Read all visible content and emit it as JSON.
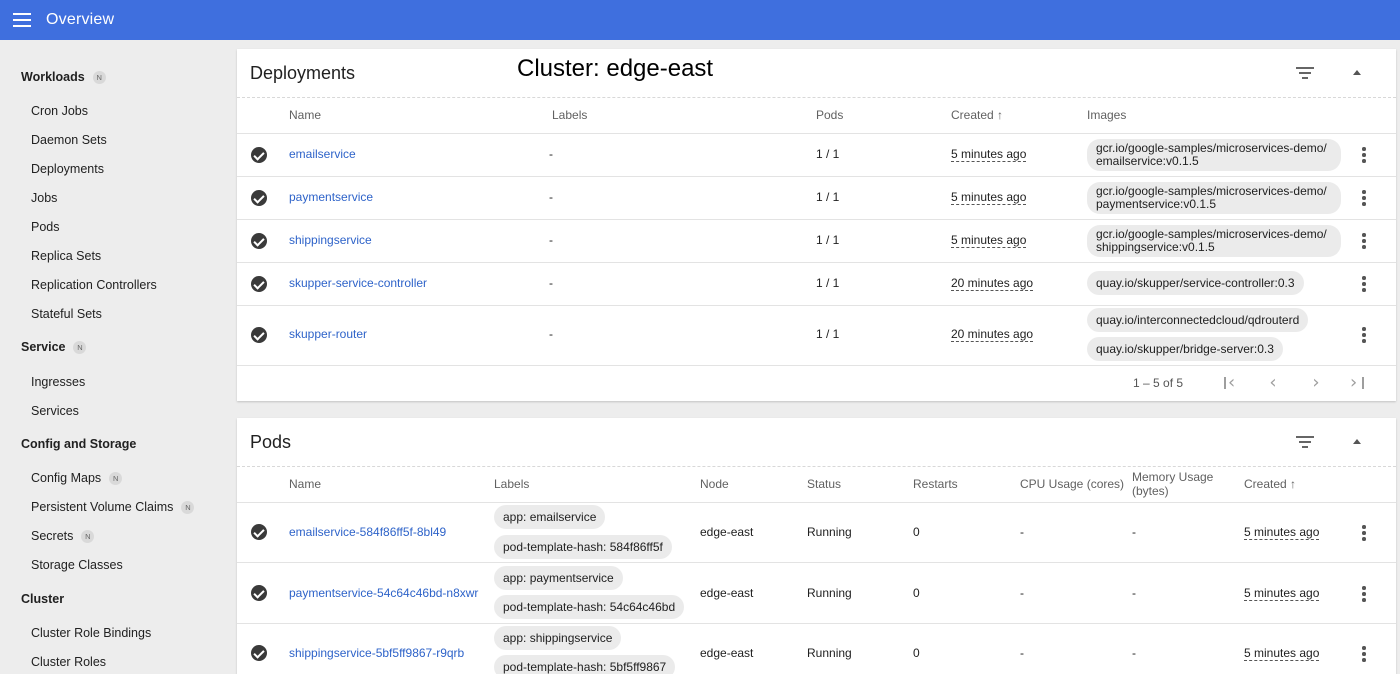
{
  "app": {
    "title": "Overview"
  },
  "sidebar": {
    "sections": [
      {
        "label": "Workloads",
        "badge": "N",
        "items": [
          {
            "label": "Cron Jobs"
          },
          {
            "label": "Daemon Sets"
          },
          {
            "label": "Deployments"
          },
          {
            "label": "Jobs"
          },
          {
            "label": "Pods"
          },
          {
            "label": "Replica Sets"
          },
          {
            "label": "Replication Controllers"
          },
          {
            "label": "Stateful Sets"
          }
        ]
      },
      {
        "label": "Service",
        "badge": "N",
        "items": [
          {
            "label": "Ingresses"
          },
          {
            "label": "Services"
          }
        ]
      },
      {
        "label": "Config and Storage",
        "badge": "",
        "items": [
          {
            "label": "Config Maps",
            "badge": "N"
          },
          {
            "label": "Persistent Volume Claims",
            "badge": "N"
          },
          {
            "label": "Secrets",
            "badge": "N"
          },
          {
            "label": "Storage Classes"
          }
        ]
      },
      {
        "label": "Cluster",
        "badge": "",
        "items": [
          {
            "label": "Cluster Role Bindings"
          },
          {
            "label": "Cluster Roles"
          }
        ]
      }
    ]
  },
  "deployments": {
    "title": "Deployments",
    "cluster_title": "Cluster: edge-east",
    "columns": {
      "name": "Name",
      "labels": "Labels",
      "pods": "Pods",
      "created": "Created",
      "created_sort": "↑",
      "images": "Images"
    },
    "rows": [
      {
        "name": "emailservice",
        "labels": "-",
        "pods": "1 / 1",
        "created": "5 minutes ago",
        "images": [
          "gcr.io/google-samples/microservices-demo/emailservice:v0.1.5"
        ]
      },
      {
        "name": "paymentservice",
        "labels": "-",
        "pods": "1 / 1",
        "created": "5 minutes ago",
        "images": [
          "gcr.io/google-samples/microservices-demo/paymentservice:v0.1.5"
        ]
      },
      {
        "name": "shippingservice",
        "labels": "-",
        "pods": "1 / 1",
        "created": "5 minutes ago",
        "images": [
          "gcr.io/google-samples/microservices-demo/shippingservice:v0.1.5"
        ]
      },
      {
        "name": "skupper-service-controller",
        "labels": "-",
        "pods": "1 / 1",
        "created": "20 minutes ago",
        "images": [
          "quay.io/skupper/service-controller:0.3"
        ]
      },
      {
        "name": "skupper-router",
        "labels": "-",
        "pods": "1 / 1",
        "created": "20 minutes ago",
        "images": [
          "quay.io/interconnectedcloud/qdrouterd",
          "quay.io/skupper/bridge-server:0.3"
        ]
      }
    ],
    "pagination": {
      "range": "1 – 5 of 5"
    }
  },
  "pods": {
    "title": "Pods",
    "columns": {
      "name": "Name",
      "labels": "Labels",
      "node": "Node",
      "status": "Status",
      "restarts": "Restarts",
      "cpu": "CPU Usage (cores)",
      "memory": "Memory Usage (bytes)",
      "created": "Created",
      "created_sort": "↑"
    },
    "rows": [
      {
        "name": "emailservice-584f86ff5f-8bl49",
        "labels": [
          "app: emailservice",
          "pod-template-hash: 584f86ff5f"
        ],
        "node": "edge-east",
        "status": "Running",
        "restarts": "0",
        "cpu": "-",
        "memory": "-",
        "created": "5 minutes ago"
      },
      {
        "name": "paymentservice-54c64c46bd-n8xwr",
        "labels": [
          "app: paymentservice",
          "pod-template-hash: 54c64c46bd"
        ],
        "node": "edge-east",
        "status": "Running",
        "restarts": "0",
        "cpu": "-",
        "memory": "-",
        "created": "5 minutes ago"
      },
      {
        "name": "shippingservice-5bf5ff9867-r9qrb",
        "labels": [
          "app: shippingservice",
          "pod-template-hash: 5bf5ff9867"
        ],
        "node": "edge-east",
        "status": "Running",
        "restarts": "0",
        "cpu": "-",
        "memory": "-",
        "created": "5 minutes ago"
      }
    ]
  },
  "icons": {
    "menu": "menu-icon",
    "filter": "filter-icon",
    "collapse": "collapse-icon",
    "status": "check-circle-icon",
    "actions": "more-vert-icon"
  },
  "colors": {
    "header": "#3f6fde",
    "link": "#2e63c9",
    "background": "#ededed"
  }
}
